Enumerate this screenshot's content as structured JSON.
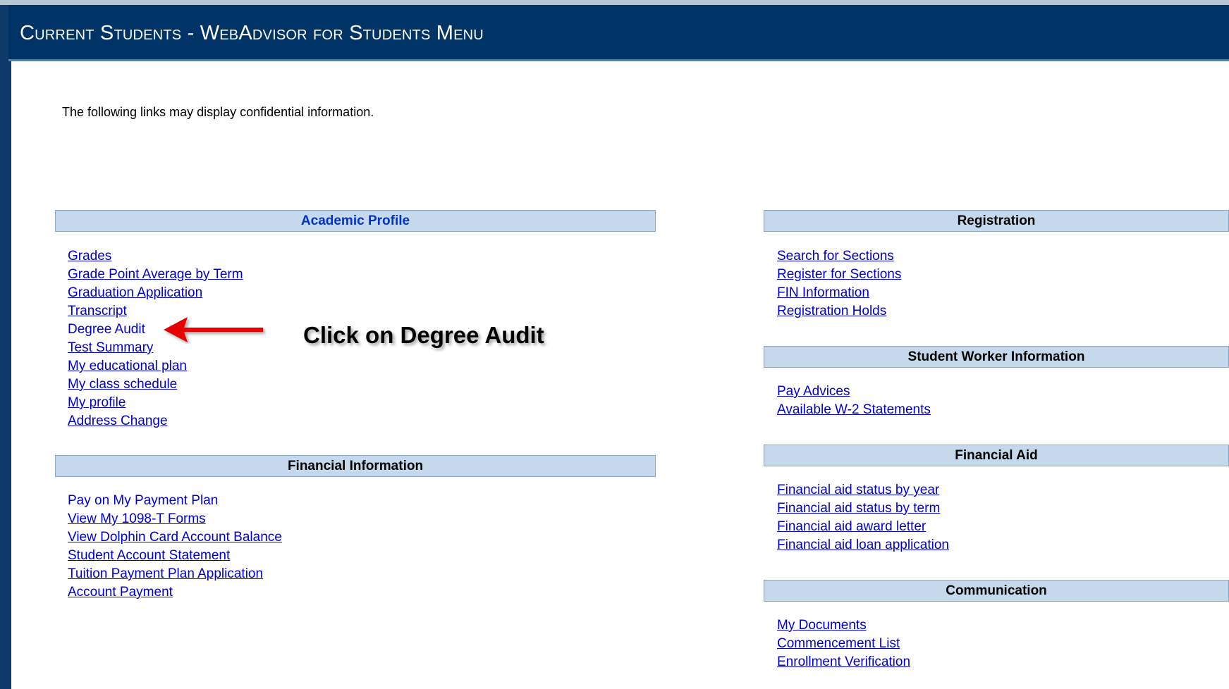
{
  "header": {
    "title": "Current Students - WebAdvisor for Students Menu"
  },
  "notice": "The following links may display confidential information.",
  "left_column": {
    "academic_profile": {
      "title": "Academic Profile",
      "links": [
        "Grades",
        "Grade Point Average by Term",
        "Graduation Application",
        "Transcript",
        "Degree Audit",
        "Test Summary",
        "My educational plan",
        "My class schedule",
        "My profile",
        "Address Change"
      ]
    },
    "financial_information": {
      "title": "Financial Information",
      "links": [
        "Pay on My Payment Plan",
        "View My 1098-T Forms",
        "View Dolphin Card Account Balance",
        "Student Account Statement",
        "Tuition Payment Plan Application",
        "Account Payment"
      ]
    }
  },
  "right_column": {
    "registration": {
      "title": "Registration",
      "links": [
        "Search for Sections",
        "Register for Sections",
        "FIN Information",
        "Registration Holds"
      ]
    },
    "student_worker": {
      "title": "Student Worker Information",
      "links": [
        "Pay Advices",
        "Available W-2 Statements"
      ]
    },
    "financial_aid": {
      "title": "Financial Aid",
      "links": [
        "Financial aid status by year",
        "Financial aid status by term",
        "Financial aid award letter",
        "Financial aid loan application"
      ]
    },
    "communication": {
      "title": "Communication",
      "links": [
        "My Documents",
        "Commencement List",
        "Enrollment Verification"
      ]
    }
  },
  "annotation": {
    "callout": "Click on Degree Audit",
    "arrow_color": "#e60000"
  },
  "colors": {
    "header_bg": "#003366",
    "section_bg": "#c6d9ec",
    "link": "#0000cc"
  }
}
